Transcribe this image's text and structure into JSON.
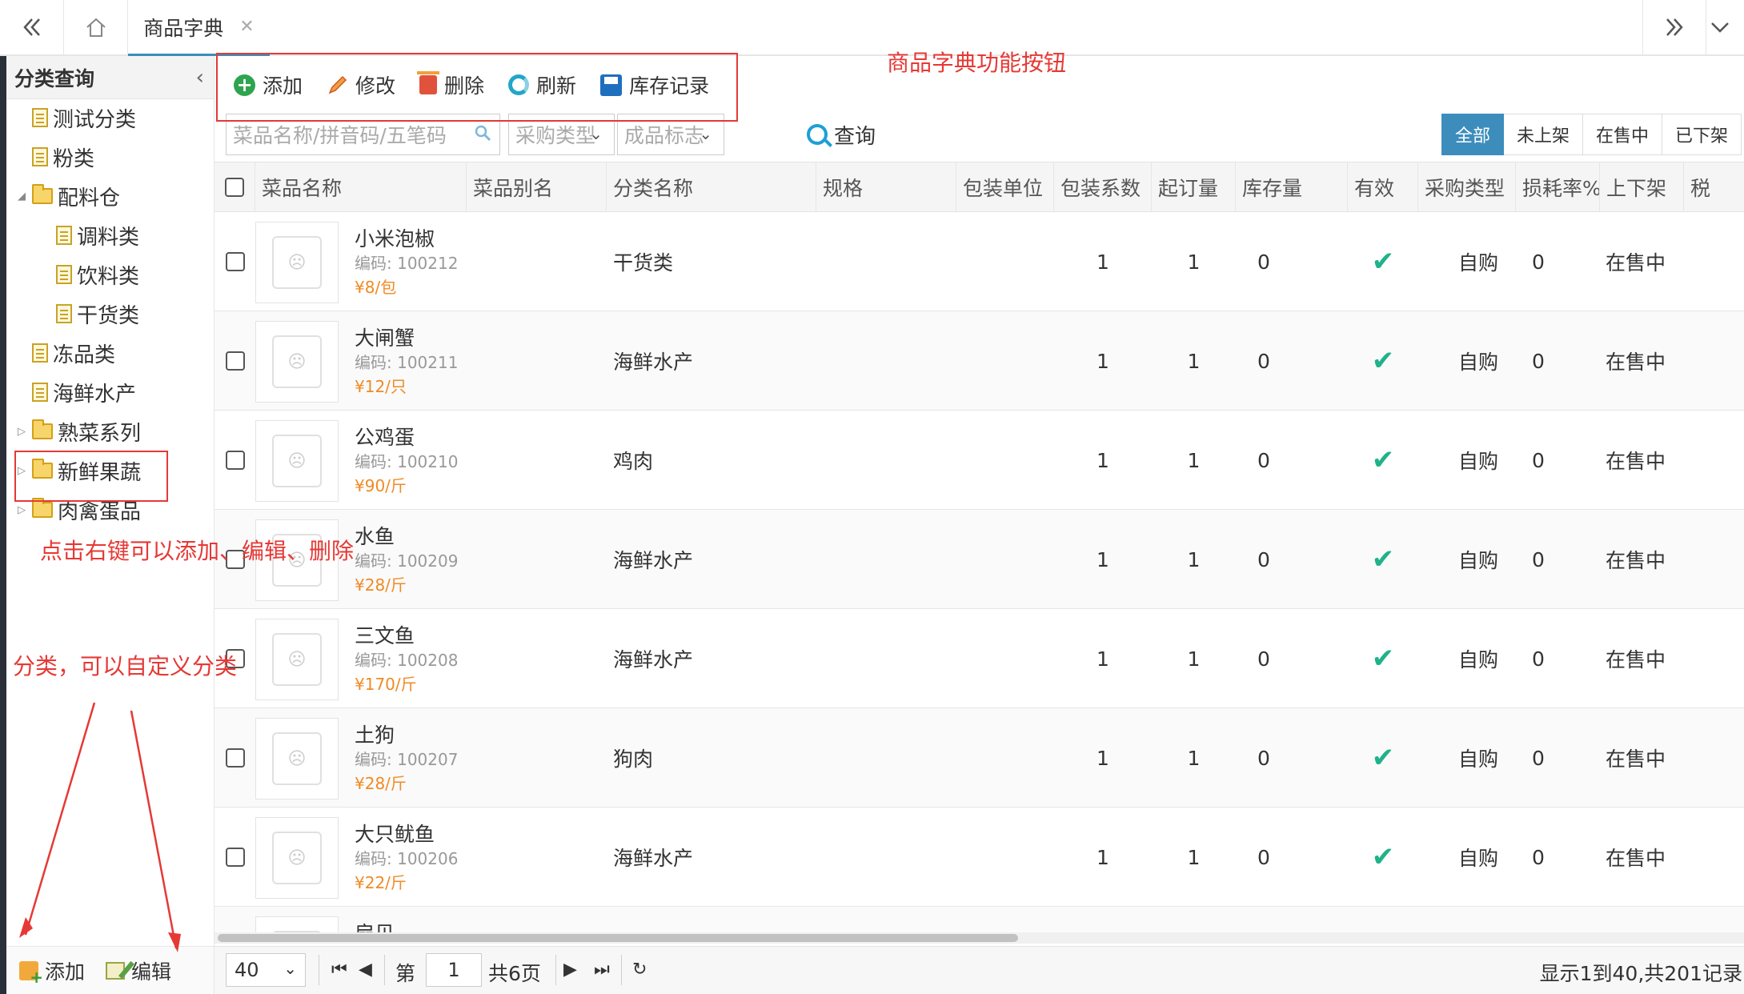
{
  "tabs": {
    "active_label": "商品字典"
  },
  "sidebar": {
    "title": "分类查询",
    "items": [
      {
        "label": "测试分类",
        "type": "doc",
        "level": 0
      },
      {
        "label": "粉类",
        "type": "doc",
        "level": 0
      },
      {
        "label": "配料仓",
        "type": "folder",
        "level": 0,
        "expanded": true
      },
      {
        "label": "调料类",
        "type": "doc",
        "level": 1
      },
      {
        "label": "饮料类",
        "type": "doc",
        "level": 1
      },
      {
        "label": "干货类",
        "type": "doc",
        "level": 1
      },
      {
        "label": "冻品类",
        "type": "doc",
        "level": 0
      },
      {
        "label": "海鲜水产",
        "type": "doc",
        "level": 0
      },
      {
        "label": "熟菜系列",
        "type": "folder",
        "level": 0,
        "expanded": false
      },
      {
        "label": "新鲜果蔬",
        "type": "folder",
        "level": 0,
        "expanded": false
      },
      {
        "label": "肉禽蛋品",
        "type": "folder",
        "level": 0,
        "expanded": false
      }
    ],
    "footer": {
      "add_label": "添加",
      "edit_label": "编辑"
    }
  },
  "toolbar": {
    "add_label": "添加",
    "edit_label": "修改",
    "delete_label": "删除",
    "refresh_label": "刷新",
    "stock_label": "库存记录"
  },
  "filter": {
    "search_placeholder": "菜品名称/拼音码/五笔码",
    "purchase_type_placeholder": "采购类型",
    "product_flag_placeholder": "成品标志",
    "query_label": "查询",
    "status_buttons": [
      "全部",
      "未上架",
      "在售中",
      "已下架"
    ],
    "status_active_index": 0
  },
  "table": {
    "columns": [
      "菜品名称",
      "菜品别名",
      "分类名称",
      "规格",
      "包装单位",
      "包装系数",
      "起订量",
      "库存量",
      "有效",
      "采购类型",
      "损耗率%",
      "上下架",
      "税"
    ],
    "rows": [
      {
        "name": "小米泡椒",
        "code": "编码: 100212",
        "price": "¥8/包",
        "category": "干货类",
        "pack_factor": "1",
        "min_order": "1",
        "stock": "0",
        "purchase_type": "自购",
        "loss_rate": "0",
        "shelf": "在售中"
      },
      {
        "name": "大闸蟹",
        "code": "编码: 100211",
        "price": "¥12/只",
        "category": "海鲜水产",
        "pack_factor": "1",
        "min_order": "1",
        "stock": "0",
        "purchase_type": "自购",
        "loss_rate": "0",
        "shelf": "在售中"
      },
      {
        "name": "公鸡蛋",
        "code": "编码: 100210",
        "price": "¥90/斤",
        "category": "鸡肉",
        "pack_factor": "1",
        "min_order": "1",
        "stock": "0",
        "purchase_type": "自购",
        "loss_rate": "0",
        "shelf": "在售中"
      },
      {
        "name": "水鱼",
        "code": "编码: 100209",
        "price": "¥28/斤",
        "category": "海鲜水产",
        "pack_factor": "1",
        "min_order": "1",
        "stock": "0",
        "purchase_type": "自购",
        "loss_rate": "0",
        "shelf": "在售中"
      },
      {
        "name": "三文鱼",
        "code": "编码: 100208",
        "price": "¥170/斤",
        "category": "海鲜水产",
        "pack_factor": "1",
        "min_order": "1",
        "stock": "0",
        "purchase_type": "自购",
        "loss_rate": "0",
        "shelf": "在售中"
      },
      {
        "name": "土狗",
        "code": "编码: 100207",
        "price": "¥28/斤",
        "category": "狗肉",
        "pack_factor": "1",
        "min_order": "1",
        "stock": "0",
        "purchase_type": "自购",
        "loss_rate": "0",
        "shelf": "在售中"
      },
      {
        "name": "大只鱿鱼",
        "code": "编码: 100206",
        "price": "¥22/斤",
        "category": "海鲜水产",
        "pack_factor": "1",
        "min_order": "1",
        "stock": "0",
        "purchase_type": "自购",
        "loss_rate": "0",
        "shelf": "在售中"
      },
      {
        "name": "扇贝",
        "code": "",
        "price": "",
        "category": "",
        "pack_factor": "",
        "min_order": "",
        "stock": "",
        "purchase_type": "",
        "loss_rate": "",
        "shelf": ""
      }
    ]
  },
  "pager": {
    "page_size": "40",
    "page_prefix": "第",
    "current_page": "1",
    "total_pages_text": "共6页",
    "summary": "显示1到40,共201记录"
  },
  "annotations": {
    "toolbar_note": "商品字典功能按钮",
    "context_note": "点击右键可以添加、编辑、删除",
    "category_note": "分类，可以自定义分类"
  },
  "colors": {
    "accent": "#3c8dbc",
    "annotation": "#e53935",
    "price": "#f08a24",
    "valid_check": "#20b28a"
  }
}
